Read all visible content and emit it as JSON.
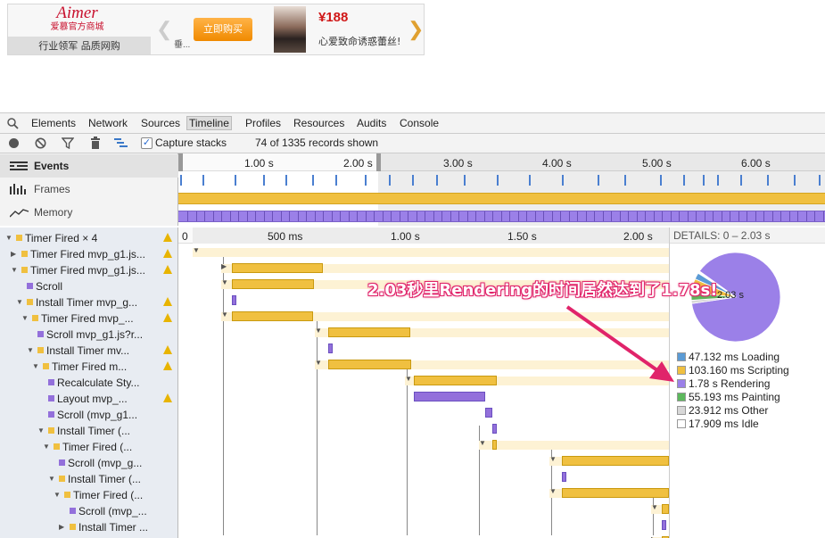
{
  "ad": {
    "logo": "Aimer",
    "logo_sub": "爱慕官方商城",
    "slogan": "行业领军 品质网购",
    "fragment": "垂...",
    "buy_label": "立即购买",
    "price": "¥188",
    "desc": "心爱致命诱惑蕾丝!"
  },
  "devtools": {
    "tabs": [
      "Elements",
      "Network",
      "Sources",
      "Timeline",
      "Profiles",
      "Resources",
      "Audits",
      "Console"
    ],
    "selected_tab": "Timeline",
    "toolbar": {
      "capture_label": "Capture stacks",
      "records_text": "74 of 1335 records shown"
    },
    "views": [
      "Events",
      "Frames",
      "Memory"
    ],
    "overview_ticks": [
      "1.00 s",
      "2.00 s",
      "3.00 s",
      "4.00 s",
      "5.00 s",
      "6.00 s"
    ],
    "ruler_ticks": [
      "0",
      "500 ms",
      "1.00 s",
      "1.50 s",
      "2.00 s"
    ],
    "records": [
      {
        "label": "Timer Fired × 4",
        "depth": 0,
        "color": "#f0c040",
        "tri": "▼",
        "warn": true
      },
      {
        "label": "Timer Fired mvp_g1.js...",
        "depth": 1,
        "color": "#f0c040",
        "tri": "▶",
        "warn": true
      },
      {
        "label": "Timer Fired mvp_g1.js...",
        "depth": 1,
        "color": "#f0c040",
        "tri": "▼",
        "warn": true
      },
      {
        "label": "Scroll",
        "depth": 2,
        "color": "#9370db",
        "tri": "",
        "warn": false
      },
      {
        "label": "Install Timer mvp_g...",
        "depth": 2,
        "color": "#f0c040",
        "tri": "▼",
        "warn": true
      },
      {
        "label": "Timer Fired mvp_...",
        "depth": 3,
        "color": "#f0c040",
        "tri": "▼",
        "warn": true
      },
      {
        "label": "Scroll mvp_g1.js?r...",
        "depth": 4,
        "color": "#9370db",
        "tri": "",
        "warn": false
      },
      {
        "label": "Install Timer mv...",
        "depth": 4,
        "color": "#f0c040",
        "tri": "▼",
        "warn": true
      },
      {
        "label": "Timer Fired m...",
        "depth": 5,
        "color": "#f0c040",
        "tri": "▼",
        "warn": true
      },
      {
        "label": "Recalculate Sty...",
        "depth": 6,
        "color": "#9370db",
        "tri": "",
        "warn": false
      },
      {
        "label": "Layout mvp_...",
        "depth": 6,
        "color": "#9370db",
        "tri": "",
        "warn": true
      },
      {
        "label": "Scroll (mvp_g1...",
        "depth": 6,
        "color": "#9370db",
        "tri": "",
        "warn": false
      },
      {
        "label": "Install Timer (...",
        "depth": 6,
        "color": "#f0c040",
        "tri": "▼",
        "warn": false
      },
      {
        "label": "Timer Fired (...",
        "depth": 7,
        "color": "#f0c040",
        "tri": "▼",
        "warn": false
      },
      {
        "label": "Scroll (mvp_g...",
        "depth": 8,
        "color": "#9370db",
        "tri": "",
        "warn": false
      },
      {
        "label": "Install Timer (...",
        "depth": 8,
        "color": "#f0c040",
        "tri": "▼",
        "warn": false
      },
      {
        "label": "Timer Fired (...",
        "depth": 9,
        "color": "#f0c040",
        "tri": "▼",
        "warn": false
      },
      {
        "label": "Scroll (mvp_...",
        "depth": 10,
        "color": "#9370db",
        "tri": "",
        "warn": false
      },
      {
        "label": "Install Timer ...",
        "depth": 10,
        "color": "#f0c040",
        "tri": "▶",
        "warn": false
      }
    ],
    "details": {
      "header": "DETAILS: 0 – 2.03 s",
      "total": "2.03 s",
      "legend": [
        {
          "label": "47.132 ms Loading",
          "value": 47.132,
          "color": "#5b9bd5"
        },
        {
          "label": "103.160 ms Scripting",
          "value": 103.16,
          "color": "#f0c040"
        },
        {
          "label": "1.78 s Rendering",
          "value": 1780,
          "color": "#9b80e8"
        },
        {
          "label": "55.193 ms Painting",
          "value": 55.193,
          "color": "#5cb85c"
        },
        {
          "label": "23.912 ms Other",
          "value": 23.912,
          "color": "#d8d8d8"
        },
        {
          "label": "17.909 ms Idle",
          "value": 17.909,
          "color": "#ffffff"
        }
      ]
    }
  },
  "annotation": "2.03秒里Rendering的时间居然达到了1.78s!"
}
